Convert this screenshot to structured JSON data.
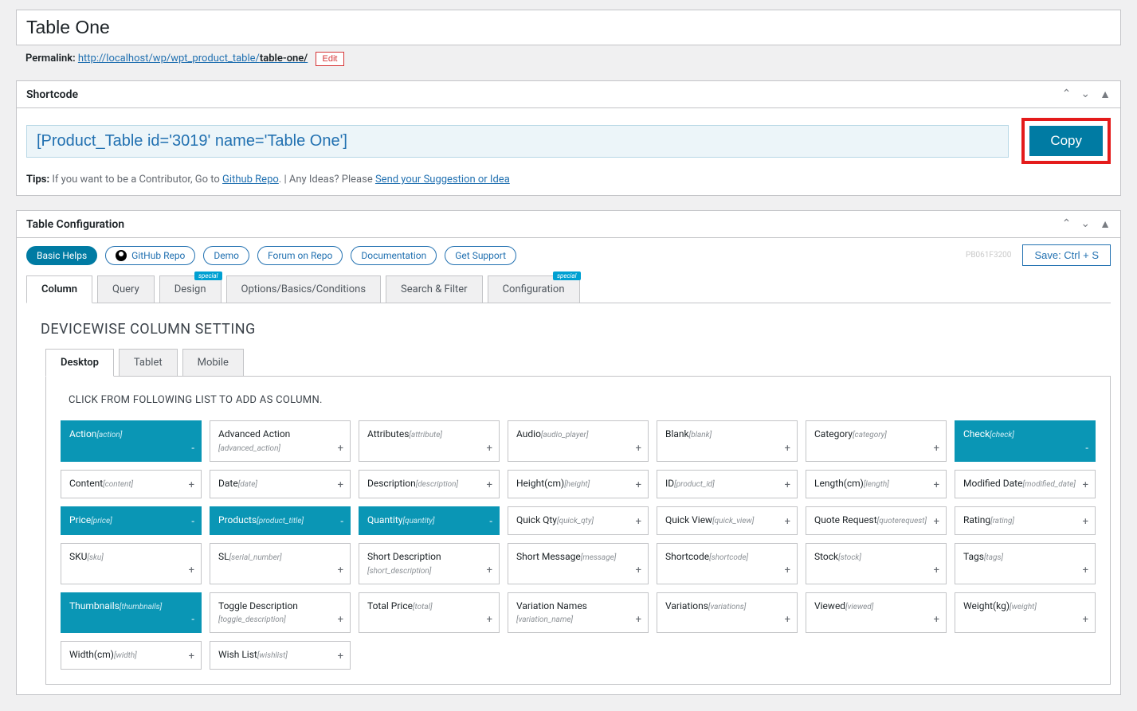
{
  "title": "Table One",
  "permalink_label": "Permalink:",
  "permalink_base": "http://localhost/wp/wpt_product_table/",
  "permalink_slug": "table-one/",
  "edit_label": "Edit",
  "shortcode_panel_title": "Shortcode",
  "shortcode_value": "[Product_Table id='3019' name='Table One']",
  "copy_label": "Copy",
  "tips_label": "Tips:",
  "tips_text1": " If you want to be a Contributor, Go to ",
  "tips_link1": "Github Repo",
  "tips_text2": ". | Any Ideas? Please ",
  "tips_link2": "Send your Suggestion or Idea",
  "config_panel_title": "Table Configuration",
  "pills": [
    "Basic Helps",
    "GitHub Repo",
    "Demo",
    "Forum on Repo",
    "Documentation",
    "Get Support"
  ],
  "save_code": "PB061F3200",
  "save_label": "Save: Ctrl + S",
  "tabs": [
    {
      "label": "Column",
      "badge": ""
    },
    {
      "label": "Query",
      "badge": ""
    },
    {
      "label": "Design",
      "badge": "special"
    },
    {
      "label": "Options/Basics/Conditions",
      "badge": ""
    },
    {
      "label": "Search & Filter",
      "badge": ""
    },
    {
      "label": "Configuration",
      "badge": "special"
    }
  ],
  "section_heading": "DEVICEWISE COLUMN SETTING",
  "device_tabs": [
    "Desktop",
    "Tablet",
    "Mobile"
  ],
  "instruction": "CLICK FROM FOLLOWING LIST TO ADD AS COLUMN.",
  "columns": [
    {
      "name": "Action",
      "slug": "[action]",
      "sel": true
    },
    {
      "name": "Advanced Action",
      "slug": "[advanced_action]",
      "sel": false,
      "multi": true
    },
    {
      "name": "Attributes",
      "slug": "[attribute]",
      "sel": false
    },
    {
      "name": "Audio",
      "slug": "[audio_player]",
      "sel": false
    },
    {
      "name": "Blank",
      "slug": "[blank]",
      "sel": false
    },
    {
      "name": "Category",
      "slug": "[category]",
      "sel": false
    },
    {
      "name": "Check",
      "slug": "[check]",
      "sel": true
    },
    {
      "name": "Content",
      "slug": "[content]",
      "sel": false
    },
    {
      "name": "Date",
      "slug": "[date]",
      "sel": false
    },
    {
      "name": "Description",
      "slug": "[description]",
      "sel": false
    },
    {
      "name": "Height(cm)",
      "slug": "[height]",
      "sel": false
    },
    {
      "name": "ID",
      "slug": "[product_id]",
      "sel": false
    },
    {
      "name": "Length(cm)",
      "slug": "[length]",
      "sel": false
    },
    {
      "name": "Modified Date",
      "slug": "[modified_date]",
      "sel": false
    },
    {
      "name": "Price",
      "slug": "[price]",
      "sel": true
    },
    {
      "name": "Products",
      "slug": "[product_title]",
      "sel": true
    },
    {
      "name": "Quantity",
      "slug": "[quantity]",
      "sel": true
    },
    {
      "name": "Quick Qty",
      "slug": "[quick_qty]",
      "sel": false
    },
    {
      "name": "Quick View",
      "slug": "[quick_view]",
      "sel": false
    },
    {
      "name": "Quote Request",
      "slug": "[quoterequest]",
      "sel": false
    },
    {
      "name": "Rating",
      "slug": "[rating]",
      "sel": false
    },
    {
      "name": "SKU",
      "slug": "[sku]",
      "sel": false
    },
    {
      "name": "SL",
      "slug": "[serial_number]",
      "sel": false
    },
    {
      "name": "Short Description",
      "slug": "[short_description]",
      "sel": false,
      "multi": true
    },
    {
      "name": "Short Message",
      "slug": "[message]",
      "sel": false
    },
    {
      "name": "Shortcode",
      "slug": "[shortcode]",
      "sel": false
    },
    {
      "name": "Stock",
      "slug": "[stock]",
      "sel": false
    },
    {
      "name": "Tags",
      "slug": "[tags]",
      "sel": false
    },
    {
      "name": "Thumbnails",
      "slug": "[thumbnails]",
      "sel": true
    },
    {
      "name": "Toggle Description",
      "slug": "[toggle_description]",
      "sel": false,
      "multi": true
    },
    {
      "name": "Total Price",
      "slug": "[total]",
      "sel": false
    },
    {
      "name": "Variation Names",
      "slug": "[variation_name]",
      "sel": false,
      "multi": true
    },
    {
      "name": "Variations",
      "slug": "[variations]",
      "sel": false
    },
    {
      "name": "Viewed",
      "slug": "[viewed]",
      "sel": false
    },
    {
      "name": "Weight(kg)",
      "slug": "[weight]",
      "sel": false
    },
    {
      "name": "Width(cm)",
      "slug": "[width]",
      "sel": false
    },
    {
      "name": "Wish List",
      "slug": "[wishlist]",
      "sel": false
    }
  ]
}
